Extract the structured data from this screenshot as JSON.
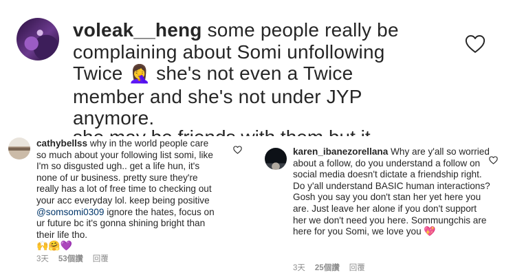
{
  "top_comment": {
    "username": "voleak__heng",
    "text_lines": [
      " some people really be",
      "complaining about Somi unfollowing",
      "Twice ",
      " she's not even a Twice",
      "member and she's not under JYP",
      "anymore."
    ],
    "emoji": "🤦‍♀️",
    "cut_off_line": "she may be friends with them but it"
  },
  "left_comment": {
    "username": "cathybellss",
    "text_before_mention": " why in the world people care so much about  your following list somi, like I'm so disgusted ugh.. get a life hun, it's none of ur business. pretty sure they're really has a lot of free time to checking out your acc everyday lol. keep being positive ",
    "mention": "@somsomi0309",
    "text_after_mention": " ignore the hates, focus on ur future bc it's gonna shining bright than their life tho.",
    "emojis": "🙌🤗💜",
    "time": "3天",
    "likes": "53個讚",
    "reply_label": "回覆"
  },
  "right_comment": {
    "username": "karen_ibanezorellana",
    "text": " Why are y'all so worried about a follow, do you understand a follow on social media doesn't dictate a friendship right. Do y'all understand BASIC human interactions? Gosh you say you don't stan her yet here you are. Just leave her alone if you don't support her we don't need you here. Sommungchis are here for you Somi, we love you ",
    "emoji": "💖",
    "time": "3天",
    "likes": "25個讚",
    "reply_label": "回覆"
  },
  "icons": {
    "like": "heart-outline-icon"
  }
}
